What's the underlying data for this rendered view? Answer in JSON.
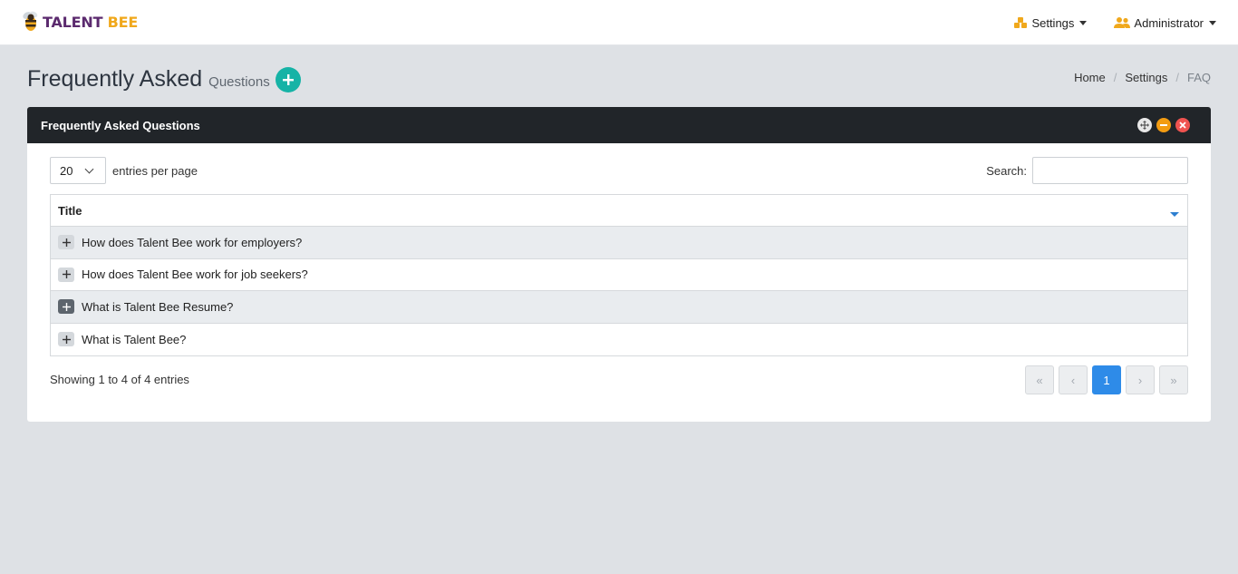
{
  "brand": {
    "part1": "TALENT",
    "part2": "BEE"
  },
  "nav": {
    "settings_label": "Settings",
    "user_label": "Administrator"
  },
  "page": {
    "title": "Frequently Asked",
    "subtitle": "Questions"
  },
  "breadcrumb": [
    "Home",
    "Settings",
    "FAQ"
  ],
  "panel": {
    "title": "Frequently Asked Questions"
  },
  "controls": {
    "page_size": "20",
    "entries_label": "entries per page",
    "search_label": "Search:",
    "search_value": ""
  },
  "table": {
    "column": "Title",
    "rows": [
      "How does Talent Bee work for employers?",
      "How does Talent Bee work for job seekers?",
      "What is Talent Bee Resume?",
      "What is Talent Bee?"
    ]
  },
  "info": "Showing 1 to 4 of 4 entries",
  "pagination": {
    "first": "«",
    "prev": "‹",
    "current": "1",
    "next": "›",
    "last": "»"
  },
  "colors": {
    "accent_teal": "#16b3a6",
    "page_active": "#2e8be8",
    "brand_purple": "#5b2a6e",
    "brand_orange": "#f0a81c"
  }
}
